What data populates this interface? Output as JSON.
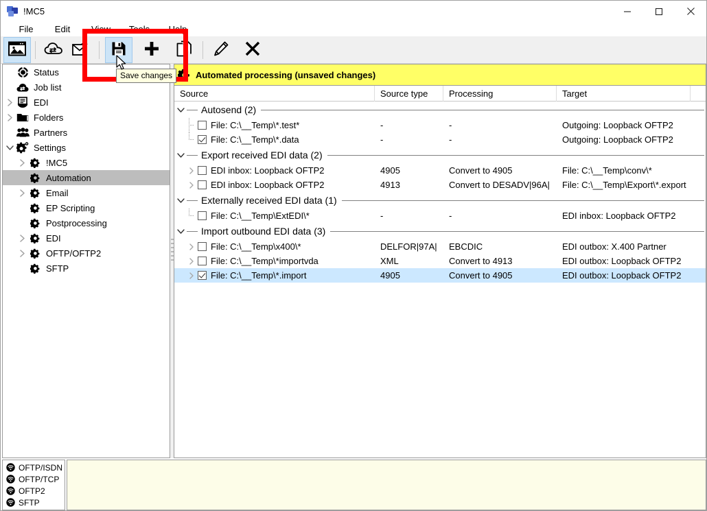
{
  "window": {
    "title": "!MC5",
    "app_icon": "app-logo-icon",
    "minimize_label": "Minimize",
    "maximize_label": "Maximize",
    "close_label": "Close"
  },
  "menubar": {
    "items": [
      {
        "label": "File"
      },
      {
        "label": "Edit"
      },
      {
        "label": "View"
      },
      {
        "label": "Tools"
      },
      {
        "label": "Help"
      }
    ]
  },
  "toolbar": {
    "buttons": [
      {
        "name": "overview-window-icon",
        "tooltip": "Overview",
        "active": true
      },
      {
        "name": "cloud-transfer-icon",
        "tooltip": "Transfer",
        "active": false
      },
      {
        "name": "receive-mail-icon",
        "tooltip": "Receive",
        "active": false
      },
      {
        "name": "save-icon",
        "tooltip": "Save changes",
        "active": true
      },
      {
        "name": "add-plus-icon",
        "tooltip": "Add",
        "active": false
      },
      {
        "name": "new-document-icon",
        "tooltip": "New",
        "active": false
      },
      {
        "name": "edit-pencil-icon",
        "tooltip": "Edit",
        "active": false
      },
      {
        "name": "delete-cross-icon",
        "tooltip": "Delete",
        "active": false
      }
    ]
  },
  "tooltip": {
    "text": "Save changes"
  },
  "sidebar": {
    "items": [
      {
        "label": "Status",
        "icon": "status-icon",
        "indent": 0,
        "arrow": "none",
        "selected": false
      },
      {
        "label": "Job list",
        "icon": "joblist-icon",
        "indent": 0,
        "arrow": "none",
        "selected": false
      },
      {
        "label": "EDI",
        "icon": "edi-icon",
        "indent": 0,
        "arrow": "collapsed",
        "selected": false
      },
      {
        "label": "Folders",
        "icon": "folder-icon",
        "indent": 0,
        "arrow": "collapsed",
        "selected": false
      },
      {
        "label": "Partners",
        "icon": "partners-icon",
        "indent": 0,
        "arrow": "none",
        "selected": false
      },
      {
        "label": "Settings",
        "icon": "settings-icon",
        "indent": 0,
        "arrow": "expanded",
        "selected": false
      },
      {
        "label": "!MC5",
        "icon": "gear-icon",
        "indent": 1,
        "arrow": "collapsed",
        "selected": false
      },
      {
        "label": "Automation",
        "icon": "gear-icon",
        "indent": 1,
        "arrow": "none",
        "selected": true
      },
      {
        "label": "Email",
        "icon": "gear-icon",
        "indent": 1,
        "arrow": "collapsed",
        "selected": false
      },
      {
        "label": "EP Scripting",
        "icon": "gear-icon",
        "indent": 1,
        "arrow": "none",
        "selected": false
      },
      {
        "label": "Postprocessing",
        "icon": "gear-icon",
        "indent": 1,
        "arrow": "none",
        "selected": false
      },
      {
        "label": "EDI",
        "icon": "gear-icon",
        "indent": 1,
        "arrow": "collapsed",
        "selected": false
      },
      {
        "label": "OFTP/OFTP2",
        "icon": "gear-icon",
        "indent": 1,
        "arrow": "collapsed",
        "selected": false
      },
      {
        "label": "SFTP",
        "icon": "gear-icon",
        "indent": 1,
        "arrow": "none",
        "selected": false
      }
    ]
  },
  "content": {
    "banner": {
      "icon": "gear-icon",
      "title": "Automated processing (unsaved changes)",
      "background": "#ffff66"
    },
    "columns": [
      {
        "key": "source",
        "label": "Source"
      },
      {
        "key": "source_type",
        "label": "Source type"
      },
      {
        "key": "processing",
        "label": "Processing"
      },
      {
        "key": "target",
        "label": "Target"
      }
    ],
    "groups": [
      {
        "label": "Autosend (2)",
        "expanded": true,
        "rows": [
          {
            "source": "File: C:\\__Temp\\*.test*",
            "source_type": "-",
            "processing": "-",
            "target": "Outgoing: Loopback OFTP2",
            "checked": false,
            "has_arrow": false,
            "selected": false
          },
          {
            "source": "File: C:\\__Temp\\*.data",
            "source_type": "-",
            "processing": "-",
            "target": "Outgoing: Loopback OFTP2",
            "checked": true,
            "has_arrow": false,
            "selected": false
          }
        ]
      },
      {
        "label": "Export received EDI data (2)",
        "expanded": true,
        "rows": [
          {
            "source": "EDI inbox: Loopback OFTP2",
            "source_type": "4905",
            "processing": "Convert to 4905",
            "target": "File: C:\\__Temp\\conv\\*",
            "checked": false,
            "has_arrow": true,
            "selected": false
          },
          {
            "source": "EDI inbox: Loopback OFTP2",
            "source_type": "4913",
            "processing": "Convert to DESADV|96A|",
            "target": "File: C:\\__Temp\\Export\\*.export",
            "checked": false,
            "has_arrow": true,
            "selected": false
          }
        ]
      },
      {
        "label": "Externally received EDI data (1)",
        "expanded": true,
        "rows": [
          {
            "source": "File: C:\\__Temp\\ExtEDI\\*",
            "source_type": "-",
            "processing": "-",
            "target": "EDI inbox: Loopback OFTP2",
            "checked": false,
            "has_arrow": false,
            "selected": false
          }
        ]
      },
      {
        "label": "Import outbound EDI data (3)",
        "expanded": true,
        "rows": [
          {
            "source": "File: C:\\__Temp\\x400\\*",
            "source_type": "DELFOR|97A|",
            "processing": "EBCDIC",
            "target": "EDI outbox: X.400 Partner",
            "checked": false,
            "has_arrow": true,
            "selected": false
          },
          {
            "source": "File: C:\\__Temp\\*importvda",
            "source_type": "XML",
            "processing": "Convert to 4913",
            "target": "EDI outbox: Loopback OFTP2",
            "checked": false,
            "has_arrow": true,
            "selected": false
          },
          {
            "source": "File: C:\\__Temp\\*.import",
            "source_type": "4905",
            "processing": "Convert to 4905",
            "target": "EDI outbox: Loopback OFTP2",
            "checked": true,
            "has_arrow": true,
            "selected": true
          }
        ]
      }
    ]
  },
  "status": {
    "connections": [
      {
        "label": "OFTP/ISDN",
        "icon": "connection-icon"
      },
      {
        "label": "OFTP/TCP",
        "icon": "connection-icon"
      },
      {
        "label": "OFTP2",
        "icon": "connection-icon"
      },
      {
        "label": "SFTP",
        "icon": "connection-icon"
      }
    ],
    "log_text": ""
  },
  "annotation": {
    "highlight_color": "#ff0000"
  }
}
